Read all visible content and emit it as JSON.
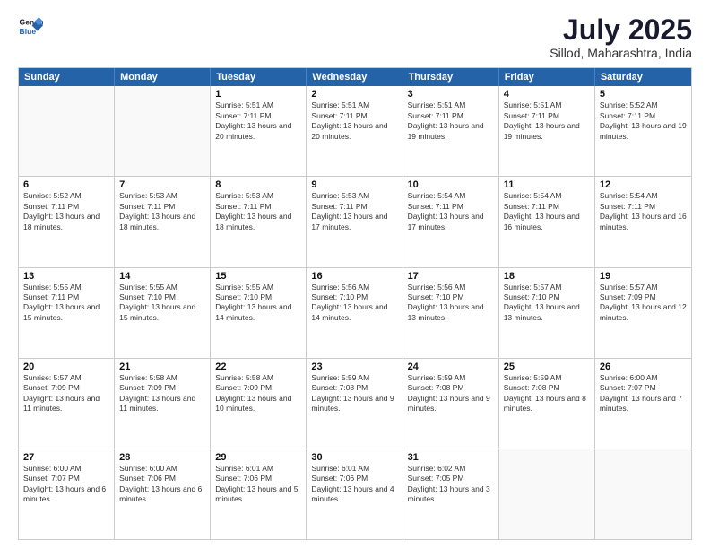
{
  "logo": {
    "line1": "General",
    "line2": "Blue"
  },
  "title": "July 2025",
  "subtitle": "Sillod, Maharashtra, India",
  "header_days": [
    "Sunday",
    "Monday",
    "Tuesday",
    "Wednesday",
    "Thursday",
    "Friday",
    "Saturday"
  ],
  "weeks": [
    [
      {
        "day": "",
        "sunrise": "",
        "sunset": "",
        "daylight": ""
      },
      {
        "day": "",
        "sunrise": "",
        "sunset": "",
        "daylight": ""
      },
      {
        "day": "1",
        "sunrise": "Sunrise: 5:51 AM",
        "sunset": "Sunset: 7:11 PM",
        "daylight": "Daylight: 13 hours and 20 minutes."
      },
      {
        "day": "2",
        "sunrise": "Sunrise: 5:51 AM",
        "sunset": "Sunset: 7:11 PM",
        "daylight": "Daylight: 13 hours and 20 minutes."
      },
      {
        "day": "3",
        "sunrise": "Sunrise: 5:51 AM",
        "sunset": "Sunset: 7:11 PM",
        "daylight": "Daylight: 13 hours and 19 minutes."
      },
      {
        "day": "4",
        "sunrise": "Sunrise: 5:51 AM",
        "sunset": "Sunset: 7:11 PM",
        "daylight": "Daylight: 13 hours and 19 minutes."
      },
      {
        "day": "5",
        "sunrise": "Sunrise: 5:52 AM",
        "sunset": "Sunset: 7:11 PM",
        "daylight": "Daylight: 13 hours and 19 minutes."
      }
    ],
    [
      {
        "day": "6",
        "sunrise": "Sunrise: 5:52 AM",
        "sunset": "Sunset: 7:11 PM",
        "daylight": "Daylight: 13 hours and 18 minutes."
      },
      {
        "day": "7",
        "sunrise": "Sunrise: 5:53 AM",
        "sunset": "Sunset: 7:11 PM",
        "daylight": "Daylight: 13 hours and 18 minutes."
      },
      {
        "day": "8",
        "sunrise": "Sunrise: 5:53 AM",
        "sunset": "Sunset: 7:11 PM",
        "daylight": "Daylight: 13 hours and 18 minutes."
      },
      {
        "day": "9",
        "sunrise": "Sunrise: 5:53 AM",
        "sunset": "Sunset: 7:11 PM",
        "daylight": "Daylight: 13 hours and 17 minutes."
      },
      {
        "day": "10",
        "sunrise": "Sunrise: 5:54 AM",
        "sunset": "Sunset: 7:11 PM",
        "daylight": "Daylight: 13 hours and 17 minutes."
      },
      {
        "day": "11",
        "sunrise": "Sunrise: 5:54 AM",
        "sunset": "Sunset: 7:11 PM",
        "daylight": "Daylight: 13 hours and 16 minutes."
      },
      {
        "day": "12",
        "sunrise": "Sunrise: 5:54 AM",
        "sunset": "Sunset: 7:11 PM",
        "daylight": "Daylight: 13 hours and 16 minutes."
      }
    ],
    [
      {
        "day": "13",
        "sunrise": "Sunrise: 5:55 AM",
        "sunset": "Sunset: 7:11 PM",
        "daylight": "Daylight: 13 hours and 15 minutes."
      },
      {
        "day": "14",
        "sunrise": "Sunrise: 5:55 AM",
        "sunset": "Sunset: 7:10 PM",
        "daylight": "Daylight: 13 hours and 15 minutes."
      },
      {
        "day": "15",
        "sunrise": "Sunrise: 5:55 AM",
        "sunset": "Sunset: 7:10 PM",
        "daylight": "Daylight: 13 hours and 14 minutes."
      },
      {
        "day": "16",
        "sunrise": "Sunrise: 5:56 AM",
        "sunset": "Sunset: 7:10 PM",
        "daylight": "Daylight: 13 hours and 14 minutes."
      },
      {
        "day": "17",
        "sunrise": "Sunrise: 5:56 AM",
        "sunset": "Sunset: 7:10 PM",
        "daylight": "Daylight: 13 hours and 13 minutes."
      },
      {
        "day": "18",
        "sunrise": "Sunrise: 5:57 AM",
        "sunset": "Sunset: 7:10 PM",
        "daylight": "Daylight: 13 hours and 13 minutes."
      },
      {
        "day": "19",
        "sunrise": "Sunrise: 5:57 AM",
        "sunset": "Sunset: 7:09 PM",
        "daylight": "Daylight: 13 hours and 12 minutes."
      }
    ],
    [
      {
        "day": "20",
        "sunrise": "Sunrise: 5:57 AM",
        "sunset": "Sunset: 7:09 PM",
        "daylight": "Daylight: 13 hours and 11 minutes."
      },
      {
        "day": "21",
        "sunrise": "Sunrise: 5:58 AM",
        "sunset": "Sunset: 7:09 PM",
        "daylight": "Daylight: 13 hours and 11 minutes."
      },
      {
        "day": "22",
        "sunrise": "Sunrise: 5:58 AM",
        "sunset": "Sunset: 7:09 PM",
        "daylight": "Daylight: 13 hours and 10 minutes."
      },
      {
        "day": "23",
        "sunrise": "Sunrise: 5:59 AM",
        "sunset": "Sunset: 7:08 PM",
        "daylight": "Daylight: 13 hours and 9 minutes."
      },
      {
        "day": "24",
        "sunrise": "Sunrise: 5:59 AM",
        "sunset": "Sunset: 7:08 PM",
        "daylight": "Daylight: 13 hours and 9 minutes."
      },
      {
        "day": "25",
        "sunrise": "Sunrise: 5:59 AM",
        "sunset": "Sunset: 7:08 PM",
        "daylight": "Daylight: 13 hours and 8 minutes."
      },
      {
        "day": "26",
        "sunrise": "Sunrise: 6:00 AM",
        "sunset": "Sunset: 7:07 PM",
        "daylight": "Daylight: 13 hours and 7 minutes."
      }
    ],
    [
      {
        "day": "27",
        "sunrise": "Sunrise: 6:00 AM",
        "sunset": "Sunset: 7:07 PM",
        "daylight": "Daylight: 13 hours and 6 minutes."
      },
      {
        "day": "28",
        "sunrise": "Sunrise: 6:00 AM",
        "sunset": "Sunset: 7:06 PM",
        "daylight": "Daylight: 13 hours and 6 minutes."
      },
      {
        "day": "29",
        "sunrise": "Sunrise: 6:01 AM",
        "sunset": "Sunset: 7:06 PM",
        "daylight": "Daylight: 13 hours and 5 minutes."
      },
      {
        "day": "30",
        "sunrise": "Sunrise: 6:01 AM",
        "sunset": "Sunset: 7:06 PM",
        "daylight": "Daylight: 13 hours and 4 minutes."
      },
      {
        "day": "31",
        "sunrise": "Sunrise: 6:02 AM",
        "sunset": "Sunset: 7:05 PM",
        "daylight": "Daylight: 13 hours and 3 minutes."
      },
      {
        "day": "",
        "sunrise": "",
        "sunset": "",
        "daylight": ""
      },
      {
        "day": "",
        "sunrise": "",
        "sunset": "",
        "daylight": ""
      }
    ]
  ]
}
